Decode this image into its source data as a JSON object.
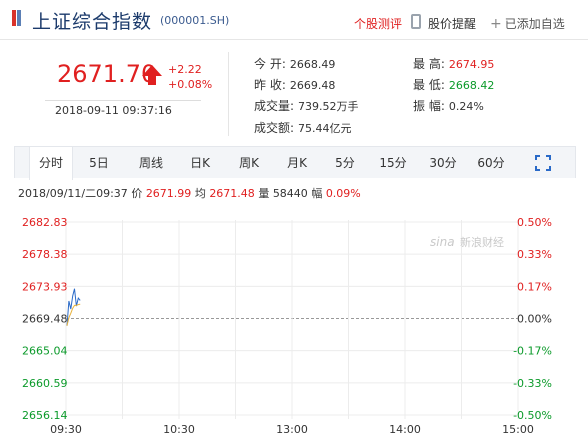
{
  "header": {
    "title": "上证综合指数",
    "code": "(000001.SH)",
    "rating_link": "个股测评",
    "alert_link": "股价提醒",
    "added_label": "已添加自选"
  },
  "quote": {
    "price": "2671.70",
    "change": "+2.22",
    "change_pct": "+0.08%",
    "datetime": "2018-09-11  09:37:16"
  },
  "stats": {
    "open_label": "今    开:",
    "open": "2668.49",
    "prev_close_label": "昨    收:",
    "prev_close": "2669.48",
    "volume_label": "成交量:",
    "volume": "739.52万手",
    "turnover_label": "成交额:",
    "turnover": "75.44亿元",
    "high_label": "最    高:",
    "high": "2674.95",
    "low_label": "最    低:",
    "low": "2668.42",
    "amplitude_label": "振    幅:",
    "amplitude": "0.24%"
  },
  "tabs": [
    "分时",
    "5日",
    "周线",
    "日K",
    "周K",
    "月K",
    "5分",
    "15分",
    "30分",
    "60分"
  ],
  "active_tab": "分时",
  "info_line": {
    "time": "2018/09/11/二09:37",
    "price_label": "价",
    "price": "2671.99",
    "avg_label": "均",
    "avg": "2671.48",
    "vol_label": "量",
    "vol": "58440",
    "amp_label": "幅",
    "amp": "0.09%"
  },
  "watermark": "新浪财经",
  "colors": {
    "up": "#e02020",
    "down": "#0b9a2a",
    "title": "#1b3a6b",
    "tab_bg": "#f3f5f8"
  },
  "chart_data": {
    "type": "line",
    "left_axis": [
      "2682.83",
      "2678.38",
      "2673.93",
      "2669.48",
      "2665.04",
      "2660.59",
      "2656.14"
    ],
    "right_axis": [
      "0.50%",
      "0.33%",
      "0.17%",
      "0.00%",
      "-0.17%",
      "-0.33%",
      "-0.50%"
    ],
    "x_ticks": [
      "09:30",
      "10:30",
      "13:00",
      "14:00",
      "15:00"
    ],
    "ylim": [
      2656.14,
      2682.83
    ],
    "baseline": 2669.48,
    "series": [
      {
        "kind": "price",
        "x": [
          "09:30",
          "09:31",
          "09:32",
          "09:33",
          "09:34",
          "09:35",
          "09:36",
          "09:37"
        ],
        "values": [
          2668.49,
          2671.9,
          2670.8,
          2672.6,
          2673.6,
          2671.2,
          2672.3,
          2671.99
        ]
      },
      {
        "kind": "average",
        "x": [
          "09:30",
          "09:31",
          "09:32",
          "09:33",
          "09:34",
          "09:35",
          "09:36",
          "09:37"
        ],
        "values": [
          2668.49,
          2669.6,
          2670.2,
          2670.9,
          2671.3,
          2671.3,
          2671.4,
          2671.48
        ]
      }
    ],
    "grid": true
  }
}
